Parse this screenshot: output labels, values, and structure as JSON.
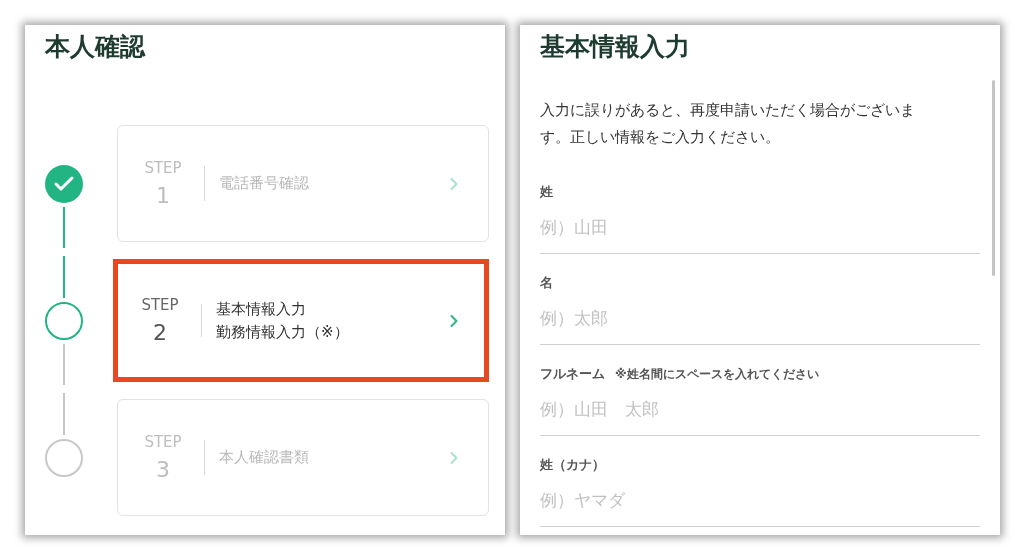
{
  "left_panel": {
    "title": "本人確認",
    "steps": [
      {
        "completed": true,
        "selected": false,
        "highlighted": false,
        "step_label": "STEP",
        "number": "1",
        "lines": [
          "電話番号確認"
        ]
      },
      {
        "completed": false,
        "selected": true,
        "highlighted": true,
        "step_label": "STEP",
        "number": "2",
        "lines": [
          "基本情報入力",
          "勤務情報入力（※）"
        ]
      },
      {
        "completed": false,
        "selected": false,
        "highlighted": false,
        "step_label": "STEP",
        "number": "3",
        "lines": [
          "本人確認書類"
        ]
      }
    ]
  },
  "right_panel": {
    "title": "基本情報入力",
    "description": "入力に誤りがあると、再度申請いただく場合がございます。正しい情報をご入力ください。",
    "fields": [
      {
        "label": "姓",
        "placeholder": "例）山田"
      },
      {
        "label": "名",
        "placeholder": "例）太郎"
      },
      {
        "label": "フルネーム",
        "note": "※姓名間にスペースを入れてください",
        "placeholder": "例）山田　太郎"
      },
      {
        "label": "姓（カナ）",
        "placeholder": "例）ヤマダ"
      }
    ]
  }
}
